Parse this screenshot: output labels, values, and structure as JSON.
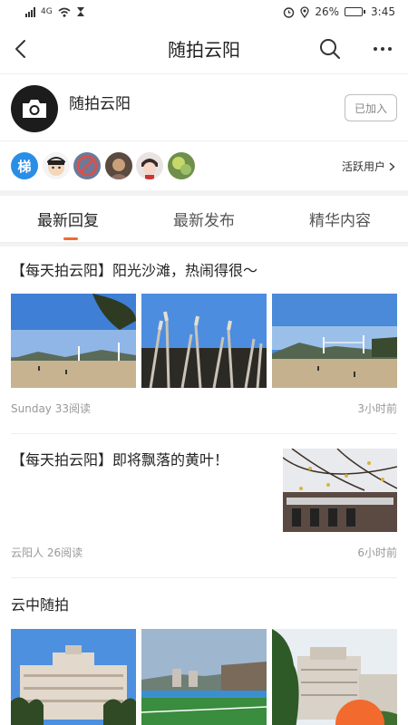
{
  "status": {
    "network": "4G",
    "battery": "26%",
    "battery_level": 0.26,
    "time": "3:45"
  },
  "nav": {
    "title": "随拍云阳"
  },
  "group": {
    "name": "随拍云阳",
    "join_label": "已加入"
  },
  "users": {
    "avatars": [
      {
        "name": "avatar-1",
        "char": "梯",
        "color": "#2b8ee6"
      },
      {
        "name": "avatar-2",
        "color": "#f3d7b8"
      },
      {
        "name": "avatar-3",
        "color": "#d5514d"
      },
      {
        "name": "avatar-4",
        "color": "#8d6e63"
      },
      {
        "name": "avatar-5",
        "color": "#e9e4e3"
      },
      {
        "name": "avatar-6",
        "color": "#9cc06a"
      }
    ],
    "active_label": "活跃用户"
  },
  "tabs": [
    {
      "label": "最新回复"
    },
    {
      "label": "最新发布"
    },
    {
      "label": "精华内容"
    }
  ],
  "posts": [
    {
      "title": "【每天拍云阳】阳光沙滩，热闹得很～",
      "author": "Sunday",
      "reads": "33阅读",
      "time": "3小时前"
    },
    {
      "title": "【每天拍云阳】即将飘落的黄叶！",
      "author": "云阳人",
      "reads": "26阅读",
      "time": "6小时前"
    }
  ],
  "section": {
    "title": "云中随拍"
  },
  "colors": {
    "accent": "#f26a2e"
  }
}
